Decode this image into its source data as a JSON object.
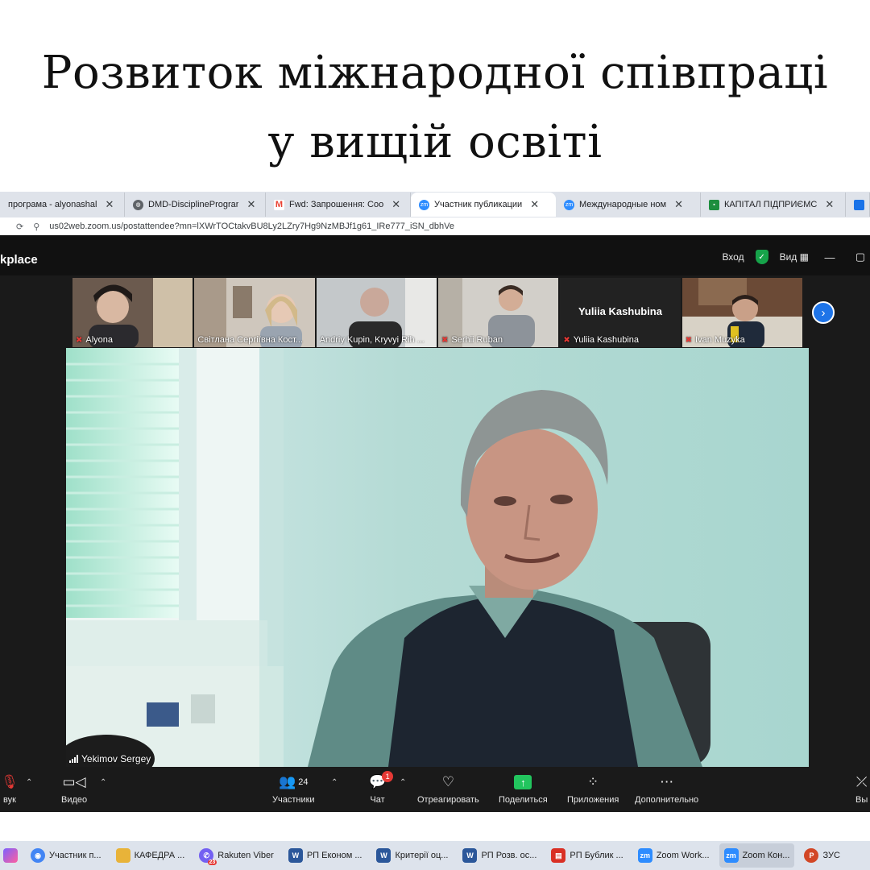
{
  "headline": {
    "line1": "Розвиток міжнародної співпраці",
    "line2": "у вищій освіті"
  },
  "browser": {
    "tabs": [
      {
        "label": "програма - alyonashal",
        "icon": "document-icon",
        "color": "#4285f4"
      },
      {
        "label": "DMD-DisciplinePrograr",
        "icon": "globe-icon",
        "color": "#5f6368"
      },
      {
        "label": "Fwd: Запрошення: Coo",
        "icon": "gmail-icon",
        "color": "#ea4335"
      },
      {
        "label": "Участник публикации",
        "icon": "zoom-icon",
        "color": "#2d8cff",
        "active": true
      },
      {
        "label": "Международные ном",
        "icon": "zoom-icon",
        "color": "#2d8cff"
      },
      {
        "label": "КАПІТАЛ ПІДПРИЄМС",
        "icon": "classroom-icon",
        "color": "#1e8e3e"
      }
    ],
    "url": "us02web.zoom.us/postattendee?mn=lXWrTOCtakvBU8Ly2LZry7Hg9NzMBJf1g61_IRe777_iSN_dbhVe"
  },
  "zoom": {
    "brand": "kplace",
    "enter_label": "Вход",
    "view_label": "Вид",
    "participants": [
      {
        "name": "Alyona",
        "muted": true,
        "bg": "#6b5a4e"
      },
      {
        "name": "Світлана Сергіївна Кост...",
        "muted": false,
        "bg": "#cfc7bd"
      },
      {
        "name": "Andriy Kupin, Kryvyi Rih ...",
        "muted": false,
        "bg": "#bfc4c6"
      },
      {
        "name": "Serhii Ruban",
        "muted": true,
        "bg": "#d2cfc9"
      },
      {
        "name": "Yuliia Kashubina",
        "muted": true,
        "bg": "#222222",
        "avatar_text": "Yuliia Kashubina"
      },
      {
        "name": "Ivan Muzyka",
        "muted": true,
        "bg": "#6b4a36"
      }
    ],
    "speaker_name": "Yekimov Sergey",
    "toolbar": {
      "audio": "вук",
      "video": "Видео",
      "participants": "Участники",
      "participants_count": "24",
      "chat": "Чат",
      "chat_badge": "1",
      "react": "Отреагировать",
      "share": "Поделиться",
      "apps": "Приложения",
      "more": "Дополнительно",
      "leave": "Вы"
    }
  },
  "taskbar": {
    "items": [
      {
        "label": "Участник п...",
        "icon": "chrome-icon",
        "color": "#4285f4"
      },
      {
        "label": "КАФЕДРА ...",
        "icon": "folder-icon",
        "color": "#e8b339"
      },
      {
        "label": "Rakuten Viber",
        "icon": "viber-icon",
        "color": "#7360f2",
        "badge": "23"
      },
      {
        "label": "РП Економ ...",
        "icon": "word-icon",
        "color": "#2b579a"
      },
      {
        "label": "Критерії оц...",
        "icon": "word-icon",
        "color": "#2b579a"
      },
      {
        "label": "РП Розв. ос...",
        "icon": "word-icon",
        "color": "#2b579a"
      },
      {
        "label": "РП Бублик ...",
        "icon": "pdf-icon",
        "color": "#d93025"
      },
      {
        "label": "Zoom Work...",
        "icon": "zoom-icon",
        "color": "#2d8cff"
      },
      {
        "label": "Zoom Кон...",
        "icon": "zoom-icon",
        "color": "#2d8cff",
        "active": true
      },
      {
        "label": "ЗУС",
        "icon": "powerpoint-icon",
        "color": "#d24726"
      }
    ]
  }
}
